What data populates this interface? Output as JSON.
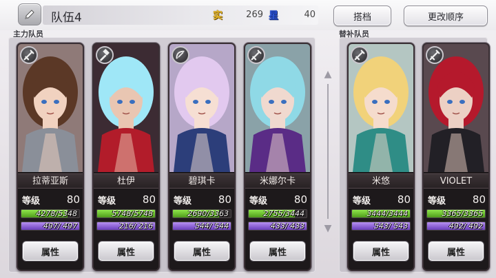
{
  "header": {
    "team_name": "队伍4",
    "cost_icon_gold": "实",
    "cost_icon_blue": "星",
    "cost_gold": "269",
    "cost_blue": "40",
    "partner_button": "搭档",
    "reorder_button": "更改顺序"
  },
  "sections": {
    "main_label": "主力队员",
    "sub_label": "替补队员"
  },
  "level_label": "等级",
  "attr_label": "属性",
  "members": [
    {
      "name": "拉蒂亚斯",
      "level": "80",
      "hp": "4278/5348",
      "hp_frac": 0.8,
      "mp": "497/ 497",
      "mp_frac": 1.0,
      "type_icon": "sword-icon",
      "hair": "#5b3826",
      "skin": "#f1d2c0",
      "outfit": "#8a8f99",
      "bg": "#8f7a78"
    },
    {
      "name": "杜伊",
      "level": "80",
      "hp": "5748/5748",
      "hp_frac": 1.0,
      "mp": "216/ 216",
      "mp_frac": 1.0,
      "type_icon": "hammer-icon",
      "hair": "#9fe7f7",
      "skin": "#e9c6b2",
      "outfit": "#b21c2a",
      "bg": "#3c2b33"
    },
    {
      "name": "碧琪卡",
      "level": "80",
      "hp": "2690/3363",
      "hp_frac": 0.8,
      "mp": "544/ 544",
      "mp_frac": 1.0,
      "type_icon": "bow-icon",
      "hair": "#e2c9ef",
      "skin": "#f6dfd3",
      "outfit": "#2c3e7a",
      "bg": "#b6a7c8"
    },
    {
      "name": "米娜尔卡",
      "level": "80",
      "hp": "2755/3444",
      "hp_frac": 0.8,
      "mp": "433/ 433",
      "mp_frac": 1.0,
      "type_icon": "sword-icon",
      "hair": "#8fd9e6",
      "skin": "#f0d9cf",
      "outfit": "#5a2c86",
      "bg": "#8aa2a8"
    },
    {
      "name": "米悠",
      "level": "80",
      "hp": "3444/3444",
      "hp_frac": 1.0,
      "mp": "543/ 543",
      "mp_frac": 1.0,
      "type_icon": "sword-icon",
      "hair": "#f1d27a",
      "skin": "#f5dccd",
      "outfit": "#2f8d86",
      "bg": "#b4c6c2"
    },
    {
      "name": "VIOLET",
      "level": "80",
      "hp": "3365/3365",
      "hp_frac": 1.0,
      "mp": "492/ 492",
      "mp_frac": 1.0,
      "type_icon": "sword-icon",
      "hair": "#b5192c",
      "skin": "#ecd0c4",
      "outfit": "#222026",
      "bg": "#59494f"
    }
  ]
}
